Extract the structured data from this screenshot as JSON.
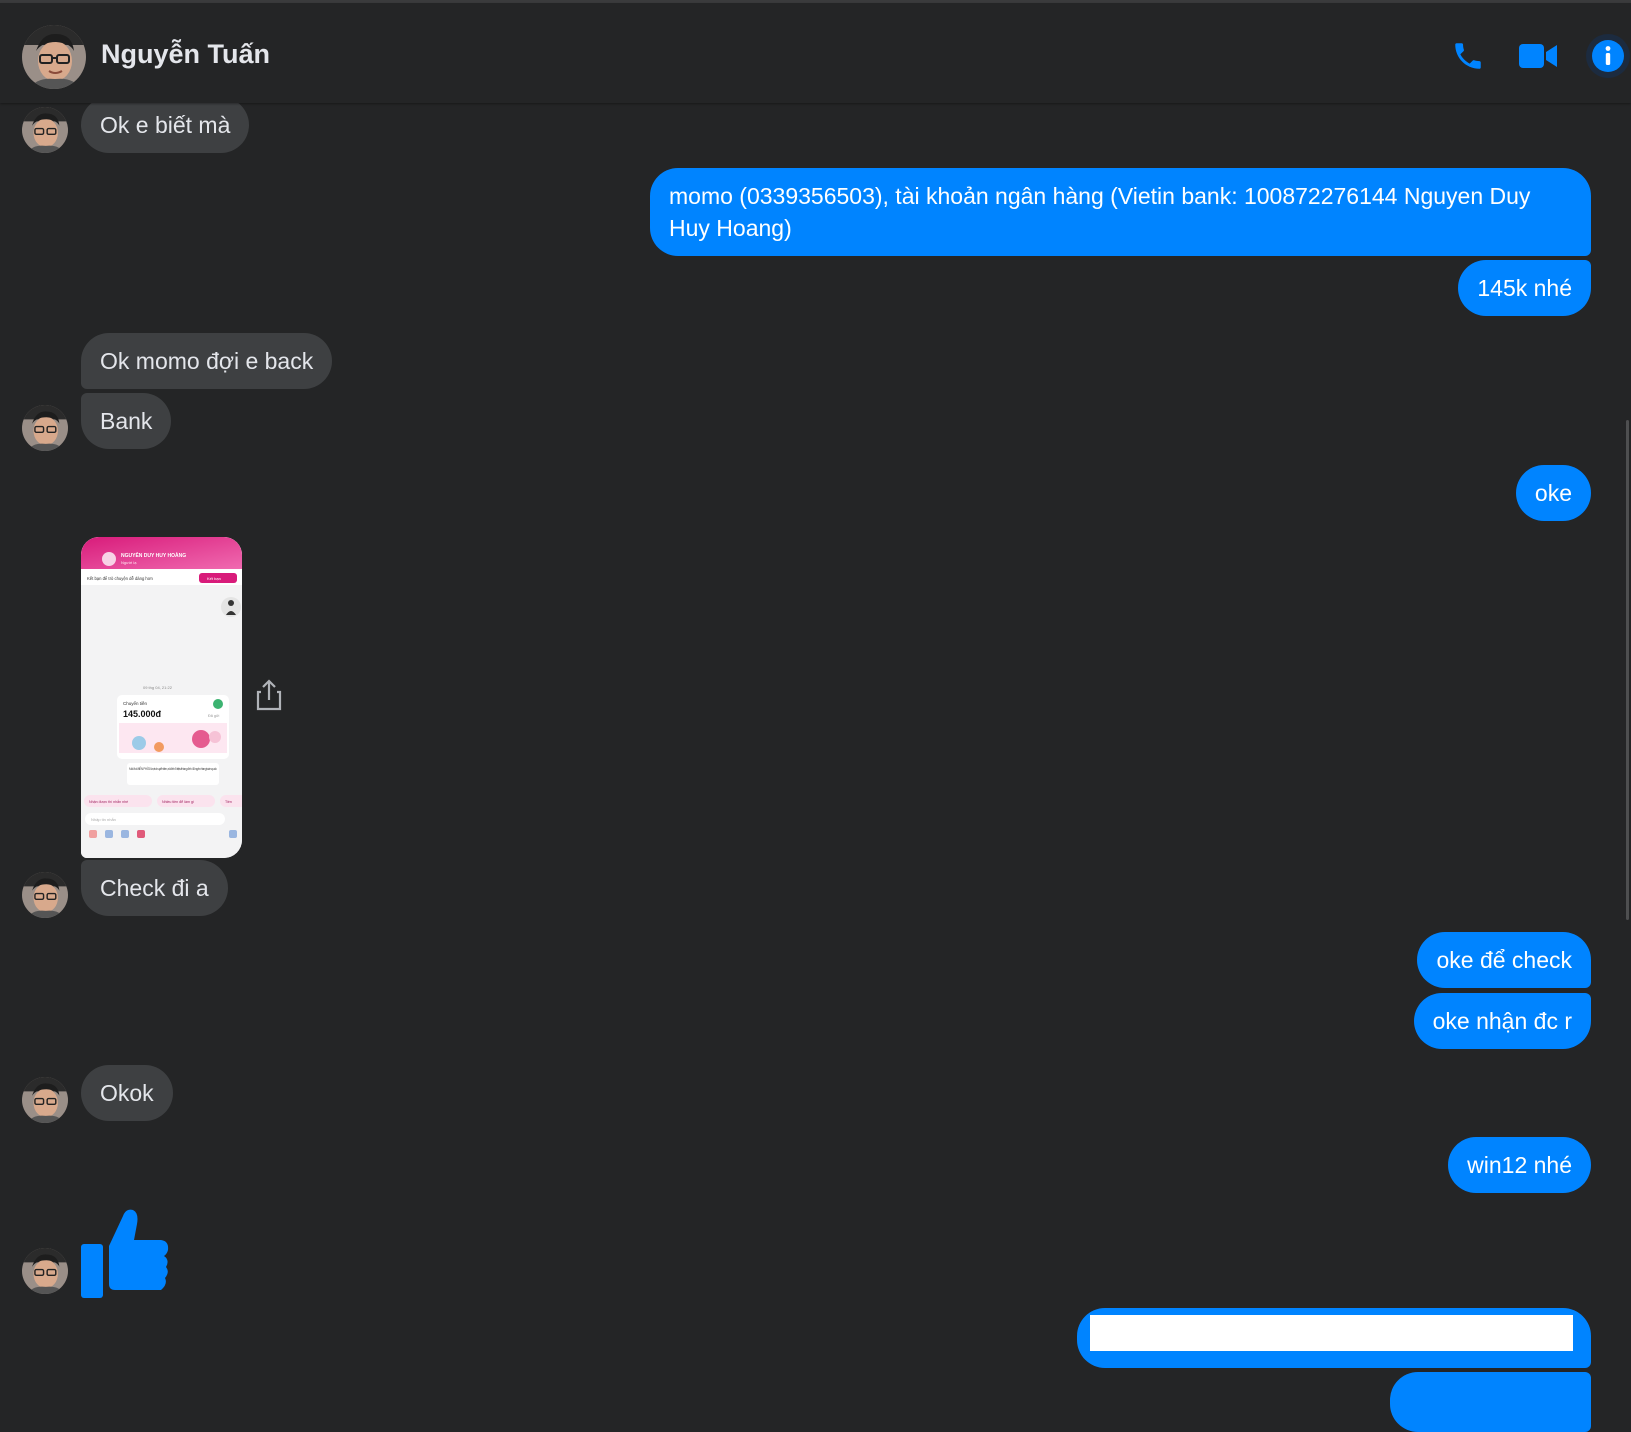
{
  "header": {
    "contact_name": "Nguyễn Tuấn",
    "call_icon": "phone-icon",
    "video_icon": "video-camera-icon",
    "info_icon": "info-icon"
  },
  "colors": {
    "background": "#242526",
    "incoming_bubble": "#3e4042",
    "outgoing_bubble": "#0084ff",
    "accent": "#0084ff"
  },
  "messages": [
    {
      "from": "contact",
      "text": "Ok e biết mà"
    },
    {
      "from": "me",
      "text": "momo (0339356503), tài khoản ngân hàng (Vietin bank: 100872276144 Nguyen Duy Huy Hoang)"
    },
    {
      "from": "me",
      "text": "145k nhé"
    },
    {
      "from": "contact",
      "text": "Ok momo đợi e back"
    },
    {
      "from": "contact",
      "text": "Bank"
    },
    {
      "from": "me",
      "text": "oke"
    },
    {
      "from": "contact",
      "type": "photo"
    },
    {
      "from": "contact",
      "text": "Check đi a"
    },
    {
      "from": "me",
      "text": "oke để check"
    },
    {
      "from": "me",
      "text": "oke nhận đc r"
    },
    {
      "from": "contact",
      "text": "Okok"
    },
    {
      "from": "me",
      "text": "win12 nhé"
    },
    {
      "from": "contact",
      "type": "like",
      "icon": "thumbs-up-icon"
    },
    {
      "from": "me",
      "type": "redacted"
    }
  ],
  "photo_content": {
    "recipient": "NGUYỄN DUY HUY HOÀNG",
    "recipient_sub": "Người lạ",
    "banner_text": "Kết bạn để trò chuyện dễ dàng hơn",
    "add_friend": "Kết bạn",
    "timestamp": "09 thg 04, 21:22",
    "transfer_label": "Chuyển tiền",
    "amount": "145.000đ",
    "status": "Đã gửi",
    "promo_text": "MoMo MIỄN PHÍ 30 lượt chuyển tiền, rút đến 5 triệu/tháng đến 45 ngân hàng toàn quốc",
    "chip_1": "Nhận được thì nhắn nhé",
    "chip_2": "Nhiều tiền để làm gì",
    "chip_3": "Tiền",
    "input_placeholder": "Nhập tin nhắn"
  }
}
